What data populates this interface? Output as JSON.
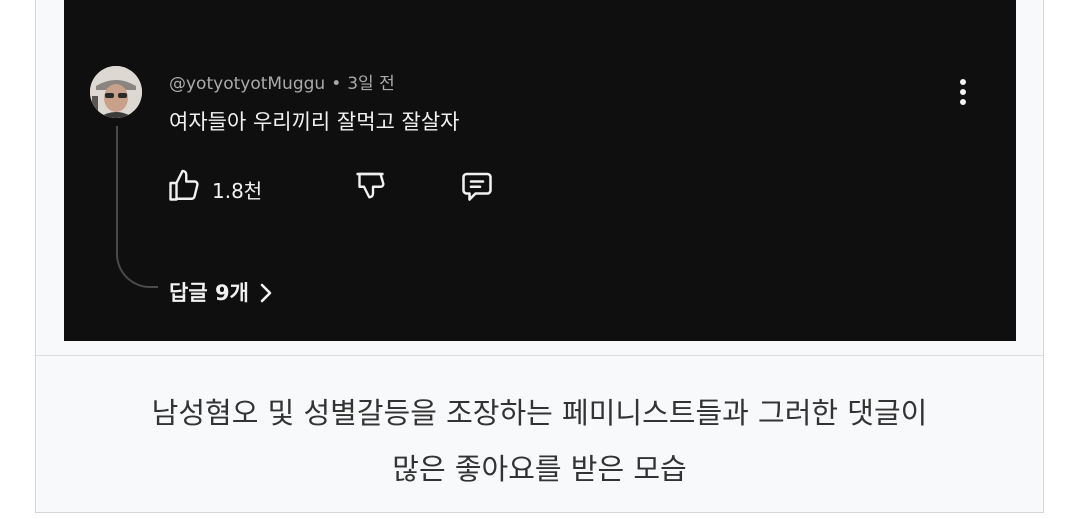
{
  "comment": {
    "author": "@yotyotyotMuggu",
    "separator": "•",
    "timestamp": "3일 전",
    "text": "여자들아 우리끼리 잘먹고 잘살자",
    "likes": "1.8천",
    "replies_label": "답글 9개"
  },
  "icons": {
    "like": "thumbs-up-icon",
    "dislike": "thumbs-down-icon",
    "reply": "comment-reply-icon",
    "menu": "more-vert-icon",
    "chevron": "chevron-right-icon"
  },
  "caption": {
    "line1": "남성혐오 및 성별갈등을 조장하는 페미니스트들과 그러한 댓글이",
    "line2": "많은 좋아요를 받은 모습"
  },
  "colors": {
    "screenshot_bg": "#0f0f0f",
    "primary_text": "#f1f1f1",
    "secondary_text": "#aaaaaa",
    "caption_text": "#333333",
    "caption_bg": "#f8f9fa"
  }
}
